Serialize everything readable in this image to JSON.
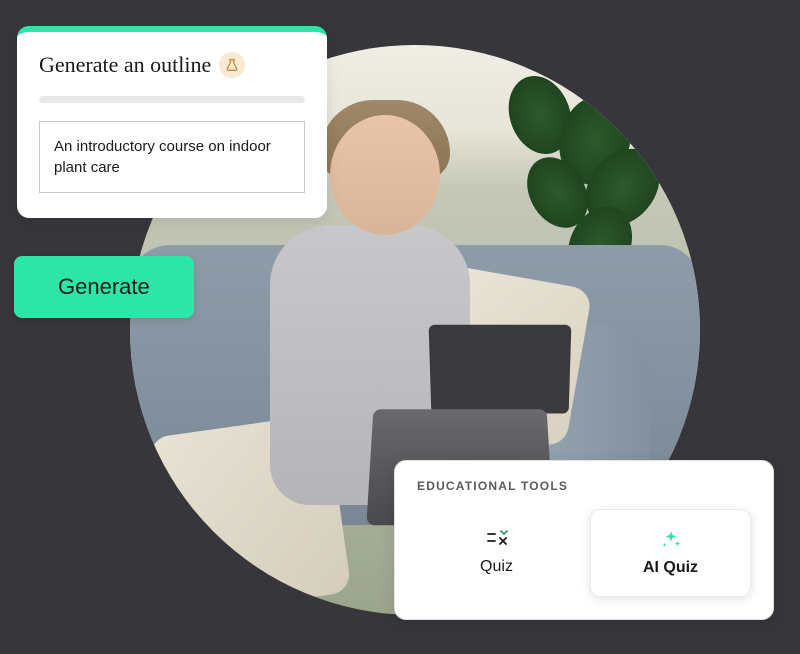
{
  "outline_card": {
    "title": "Generate an outline",
    "input_value": "An introductory course on indoor plant care"
  },
  "generate_button": {
    "label": "Generate"
  },
  "tools_card": {
    "heading": "EDUCATIONAL TOOLS",
    "items": [
      {
        "label": "Quiz",
        "icon": "quiz-icon"
      },
      {
        "label": "AI Quiz",
        "icon": "sparkle-icon"
      }
    ]
  },
  "colors": {
    "accent": "#2ce6a8"
  }
}
